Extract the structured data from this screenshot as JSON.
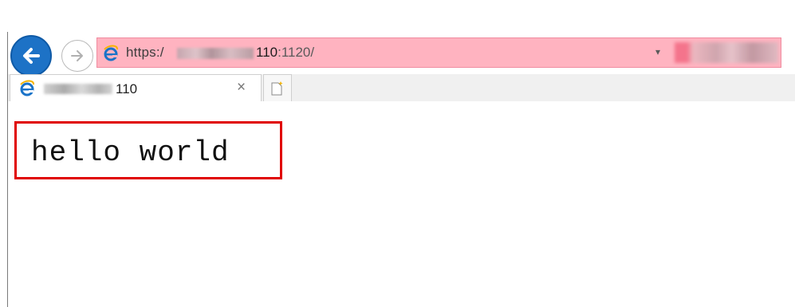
{
  "browser": {
    "address_bar": {
      "url_prefix": "https:/",
      "url_host_suffix": "110",
      "url_port_path": ":1120/",
      "dropdown_glyph": "▾",
      "background_color": "#ffb3c0"
    },
    "tab": {
      "title_suffix": "110",
      "close_glyph": "×"
    },
    "icons": {
      "back": "back-arrow-icon",
      "forward": "forward-arrow-icon",
      "site": "ie-logo-icon",
      "new_tab": "new-tab-icon"
    }
  },
  "page": {
    "content_text": "hello world",
    "highlight_border_color": "#e00000"
  }
}
